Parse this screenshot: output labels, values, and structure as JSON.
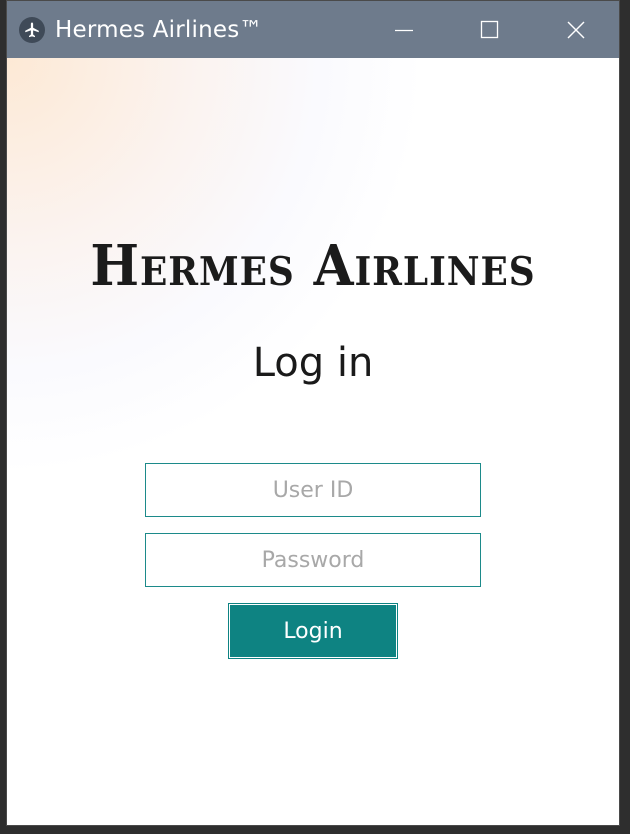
{
  "window": {
    "title": "Hermes Airlines™",
    "app_icon": "airplane-icon",
    "controls": [
      "minimize-icon",
      "maximize-icon",
      "close-icon"
    ]
  },
  "main": {
    "brand": "Hermes Airlines",
    "heading": "Log in",
    "user_id_placeholder": "User ID",
    "user_id_value": "",
    "password_placeholder": "Password",
    "password_value": "",
    "login_label": "Login"
  },
  "colors": {
    "titlebar": "#6e7b8c",
    "accent": "#0e8382",
    "field_border": "#1c8a8a"
  }
}
